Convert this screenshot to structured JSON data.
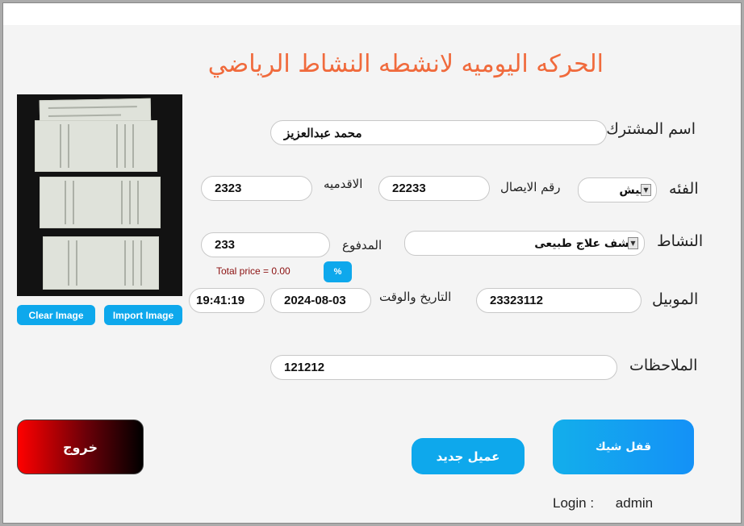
{
  "title": "الحركه اليوميه لانشطه النشاط الرياضي",
  "image_panel": {
    "clear_label": "Clear Image",
    "import_label": "Import Image"
  },
  "form": {
    "subscriber_label": "اسم المشترك",
    "subscriber_value": "محمد عبدالعزيز",
    "category_label": "الفئه",
    "category_value": "جيش",
    "receipt_label": "رقم الايصال",
    "receipt_value": "22233",
    "seniority_label": "الاقدميه",
    "seniority_value": "2323",
    "activity_label": "النشاط",
    "activity_value": "كشف علاج طبيعى",
    "paid_label": "المدفوع",
    "paid_value": "233",
    "total_price": "Total price = 0.00",
    "percent_label": "%",
    "mobile_label": "الموبيل",
    "mobile_value": "23323112",
    "datetime_label": "التاريخ والوقت",
    "date_value": "2024-08-03",
    "time_value": "19:41:19",
    "notes_label": "الملاحظات",
    "notes_value": "121212"
  },
  "buttons": {
    "exit": "خروج",
    "new_client": "عميل جديد",
    "check_lock": "قفل شيك"
  },
  "login": {
    "label": "Login :",
    "user": "admin"
  },
  "colors": {
    "title": "#f06a3c",
    "accent": "#0ea8ec",
    "exit_start": "#ff0000",
    "total_text": "#8b1010"
  }
}
